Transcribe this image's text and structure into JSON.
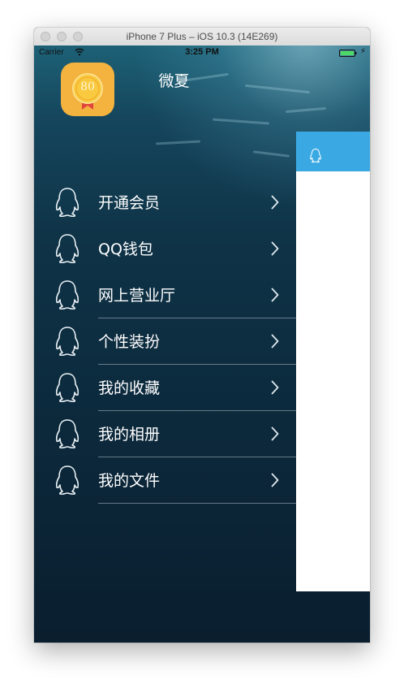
{
  "window": {
    "title": "iPhone 7 Plus – iOS 10.3 (14E269)"
  },
  "status_bar": {
    "carrier": "Carrier",
    "time": "3:25 PM",
    "battery_color": "#4cd964"
  },
  "profile": {
    "level": "80",
    "badge_color": "#f4b23f"
  },
  "header": {
    "title": "微夏"
  },
  "menu": {
    "items": [
      {
        "label": "开通会员",
        "icon": "penguin-icon"
      },
      {
        "label": "QQ钱包",
        "icon": "penguin-icon"
      },
      {
        "label": "网上营业厅",
        "icon": "penguin-icon"
      },
      {
        "label": "个性装扮",
        "icon": "penguin-icon"
      },
      {
        "label": "我的收藏",
        "icon": "penguin-icon"
      },
      {
        "label": "我的相册",
        "icon": "penguin-icon"
      },
      {
        "label": "我的文件",
        "icon": "penguin-icon"
      }
    ]
  },
  "content_card": {
    "header_color": "#3aa9e3",
    "header_icon": "penguin-icon"
  }
}
